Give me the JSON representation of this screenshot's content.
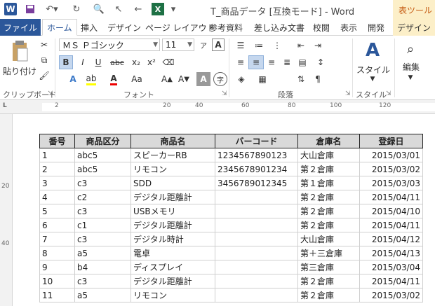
{
  "titlebar": {
    "app_logo": "W",
    "title": "T_商品データ [互換モード] - Word",
    "context_group": "表ツール"
  },
  "tabs": [
    "ファイル",
    "ホーム",
    "挿入",
    "デザイン",
    "ページ レイアウト",
    "参考資料",
    "差し込み文書",
    "校閲",
    "表示",
    "開発",
    "デザイン"
  ],
  "ribbon": {
    "clipboard": {
      "paste": "貼り付け",
      "label": "クリップボード"
    },
    "font": {
      "name": "ＭＳ Ｐゴシック",
      "size": "11",
      "label": "フォント"
    },
    "paragraph": {
      "label": "段落"
    },
    "styles": {
      "button": "スタイル",
      "label": "スタイル"
    },
    "editing": {
      "button": "編集"
    }
  },
  "ruler": {
    "h_numbers": [
      "2",
      "20",
      "40",
      "60",
      "80",
      "100",
      "120"
    ],
    "v_numbers": [
      "20",
      "40"
    ]
  },
  "table": {
    "headers": [
      "番号",
      "商品区分",
      "商品名",
      "バーコード",
      "倉庫名",
      "登録日"
    ],
    "rows": [
      [
        "1",
        "abc5",
        "スピーカーRB",
        "1234567890123",
        "大山倉庫",
        "2015/03/01"
      ],
      [
        "2",
        "abc5",
        "リモコン",
        "2345678901234",
        "第２倉庫",
        "2015/03/02"
      ],
      [
        "3",
        "c3",
        "SDD",
        "3456789012345",
        "第１倉庫",
        "2015/03/03"
      ],
      [
        "4",
        "c2",
        "デジタル距離計",
        "",
        "第２倉庫",
        "2015/04/11"
      ],
      [
        "5",
        "c3",
        "USBメモリ",
        "",
        "第２倉庫",
        "2015/04/10"
      ],
      [
        "6",
        "c1",
        "デジタル距離計",
        "",
        "第２倉庫",
        "2015/04/11"
      ],
      [
        "7",
        "c3",
        "デジタル時計",
        "",
        "大山倉庫",
        "2015/04/12"
      ],
      [
        "8",
        "a5",
        "電卓",
        "",
        "第＋三倉庫",
        "2015/04/13"
      ],
      [
        "9",
        "b4",
        "ディスプレイ",
        "",
        "第三倉庫",
        "2015/03/04"
      ],
      [
        "10",
        "c3",
        "デジタル距離計",
        "",
        "第２倉庫",
        "2015/04/11"
      ],
      [
        "11",
        "a5",
        "リモコン",
        "",
        "第２倉庫",
        "2015/03/02"
      ]
    ]
  }
}
